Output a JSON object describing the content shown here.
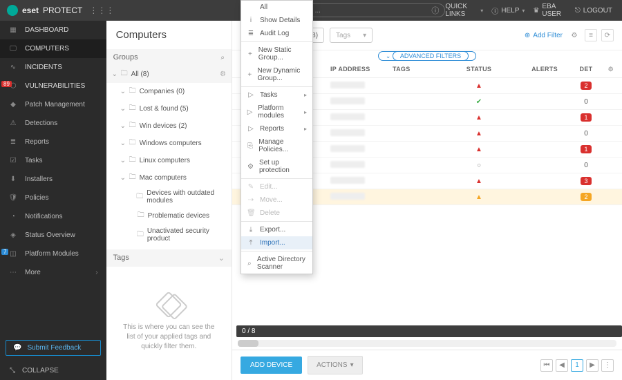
{
  "topbar": {
    "brand1": "eset",
    "brand2": "PROTECT",
    "search_placeholder": "e to search ...",
    "quick_links": "QUICK LINKS",
    "help": "HELP",
    "user": "EBA USER",
    "logout": "LOGOUT"
  },
  "sidebar": {
    "items": [
      {
        "label": "DASHBOARD"
      },
      {
        "label": "COMPUTERS"
      },
      {
        "label": "INCIDENTS"
      },
      {
        "label": "VULNERABILITIES",
        "badge": "89"
      },
      {
        "label": "Patch Management"
      },
      {
        "label": "Detections"
      },
      {
        "label": "Reports"
      },
      {
        "label": "Tasks"
      },
      {
        "label": "Installers"
      },
      {
        "label": "Policies"
      },
      {
        "label": "Notifications"
      },
      {
        "label": "Status Overview"
      },
      {
        "label": "Platform Modules",
        "badge_b": "7"
      },
      {
        "label": "More"
      }
    ],
    "feedback": "Submit Feedback",
    "collapse": "COLLAPSE"
  },
  "panel": {
    "title": "Computers",
    "groups": "Groups",
    "tree": [
      {
        "label": "All (8)",
        "ind": 0,
        "sel": true,
        "gear": true,
        "open": true
      },
      {
        "label": "Companies (0)",
        "ind": 1,
        "open": true
      },
      {
        "label": "Lost & found (5)",
        "ind": 1,
        "open": true
      },
      {
        "label": "Win devices (2)",
        "ind": 1,
        "open": true
      },
      {
        "label": "Windows computers",
        "ind": 1,
        "open": true
      },
      {
        "label": "Linux computers",
        "ind": 1,
        "open": true
      },
      {
        "label": "Mac computers",
        "ind": 1,
        "open": true
      },
      {
        "label": "Devices with outdated modules",
        "ind": 2
      },
      {
        "label": "Problematic devices",
        "ind": 2
      },
      {
        "label": "Unactivated security product",
        "ind": 2
      }
    ],
    "tags_header": "Tags",
    "tags_empty": "This is where you can see the list of your applied tags and quickly filter them."
  },
  "filter": {
    "all_label": "All (8)",
    "tags_label": "Tags",
    "add_filter": "Add Filter",
    "advanced": "ADVANCED FILTERS"
  },
  "columns": {
    "ip": "IP ADDRESS",
    "tags": "TAGS",
    "status": "STATUS",
    "alerts": "ALERTS",
    "det": "DET"
  },
  "rows": [
    {
      "warn": false,
      "name": "red",
      "status": "warn",
      "alerts": "",
      "det": "2",
      "detcolor": "r"
    },
    {
      "warn": false,
      "name": "red",
      "status": "ok",
      "alerts": "",
      "det": "0"
    },
    {
      "warn": false,
      "name": "red",
      "status": "warn",
      "alerts": "",
      "det": "1",
      "detcolor": "r"
    },
    {
      "warn": false,
      "name": "red",
      "status": "warn",
      "alerts": "",
      "det": "0"
    },
    {
      "warn": false,
      "name": "red",
      "status": "warn",
      "alerts": "",
      "det": "1",
      "detcolor": "r"
    },
    {
      "warn": false,
      "name": "red",
      "status": "circle",
      "alerts": "",
      "det": "0"
    },
    {
      "warn": false,
      "name": "red",
      "status": "warn",
      "alerts": "",
      "det": "3",
      "detcolor": "r"
    },
    {
      "warn": true,
      "name": "orange",
      "status": "owarn",
      "alerts": "",
      "det": "2",
      "detcolor": "o"
    }
  ],
  "selcount": "0 / 8",
  "footer": {
    "add": "ADD DEVICE",
    "actions": "ACTIONS",
    "page": "1"
  },
  "ctx": {
    "items": [
      {
        "label": "All",
        "icon": ""
      },
      {
        "label": "Show Details",
        "icon": "i"
      },
      {
        "label": "Audit Log",
        "icon": "≣"
      },
      {
        "sep": true
      },
      {
        "label": "New Static Group...",
        "icon": "+"
      },
      {
        "label": "New Dynamic Group...",
        "icon": "+"
      },
      {
        "sep": true
      },
      {
        "label": "Tasks",
        "icon": "▷",
        "sub": true
      },
      {
        "label": "Platform modules",
        "icon": "▷",
        "sub": true
      },
      {
        "label": "Reports",
        "icon": "▷",
        "sub": true
      },
      {
        "label": "Manage Policies...",
        "icon": "⎘"
      },
      {
        "label": "Set up protection",
        "icon": "⚙"
      },
      {
        "sep": true
      },
      {
        "label": "Edit...",
        "icon": "✎",
        "dis": true
      },
      {
        "label": "Move...",
        "icon": "⇢",
        "dis": true
      },
      {
        "label": "Delete",
        "icon": "🗑",
        "dis": true
      },
      {
        "sep": true
      },
      {
        "label": "Export...",
        "icon": "⤓"
      },
      {
        "label": "Import...",
        "icon": "⤒",
        "hover": true
      },
      {
        "sep": true
      },
      {
        "label": "Active Directory Scanner",
        "icon": "⌕"
      }
    ]
  }
}
